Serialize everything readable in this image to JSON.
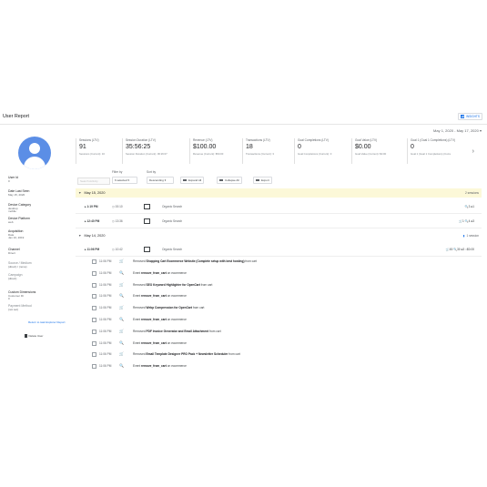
{
  "header": {
    "title": "User Report",
    "insights_label": "INSIGHTS"
  },
  "date_range": "May 1, 2020 - May 17, 2020",
  "user": {
    "fields": [
      {
        "label": "User Id",
        "value": "0"
      },
      {
        "label": "Date Last Seen",
        "value": "May 15, 2020"
      },
      {
        "label": "Device Category",
        "value": "desktop\nmobile"
      },
      {
        "label": "Device Platform",
        "value": "web"
      },
      {
        "label": "Acquisition",
        "value": "Date\nJan 10, 2019"
      },
      {
        "label": "Channel",
        "value": "Direct"
      },
      {
        "label": "Source / Medium",
        "value": "(direct) / (none)"
      },
      {
        "label": "Campaign",
        "value": "(direct)"
      },
      {
        "label": "Custom Dimensions",
        "value": "Customer ID\n0"
      },
      {
        "label": "Payment Method",
        "value": "(not set)"
      }
    ],
    "back_link": "Return to task Explorer Report",
    "delete_label": "Delete User"
  },
  "metrics": [
    {
      "label": "Sessions (LTV)",
      "value": "91",
      "sub": "Sessions (Current): 16"
    },
    {
      "label": "Session Duration (LTV)",
      "value": "35:56:25",
      "sub": "Session Duration (Current): 06:26:07"
    },
    {
      "label": "Revenue (LTV)",
      "value": "$100.00",
      "sub": "Revenue (Current): $50.00"
    },
    {
      "label": "Transactions (LTV)",
      "value": "18",
      "sub": "Transactions (Current): 3"
    },
    {
      "label": "Goal Completions (LTV)",
      "value": "0",
      "sub": "Goal Completions (Current): 0"
    },
    {
      "label": "Goal Value (LTV)",
      "value": "$0.00",
      "sub": "Goal Value (Current): $0.00"
    },
    {
      "label": "Goal 1 (Goal 1 Completions) (LTV)",
      "value": "0",
      "sub": "Goal 1 (Goal 1 Completions) (Curre"
    }
  ],
  "filters": {
    "filter_by_label": "Filter by",
    "filter_by_value": "6 selected",
    "sort_by_label": "Sort by",
    "sort_by_value": "Descending",
    "expand_label": "Expand All",
    "collapse_label": "Collapse All",
    "export_label": "Export",
    "search_placeholder": "Search Activity"
  },
  "days": [
    {
      "date": "May 15, 2020",
      "right": "2 sessions"
    },
    {
      "date": "May 14, 2020",
      "right": "1 session"
    }
  ],
  "sessions": [
    {
      "time": "1:19 PM",
      "duration": "00:10",
      "source": "Organic Search",
      "right": "🔍3 ●1"
    },
    {
      "time": "12:40 PM",
      "duration": "13:36",
      "source": "Organic Search",
      "right": "🛒1 🔍4 ●3"
    },
    {
      "time": "11:06 PM",
      "duration": "10:42",
      "source": "Organic Search",
      "right": "🛒45 🔍30 ●3 ○$0.00"
    }
  ],
  "events": [
    {
      "time": "11:06 PM",
      "icon": "cart",
      "pre": "Removed ",
      "bold": "Shopping Cart Ecommerce Website (Complete setup with best hosting)",
      "post": " from cart"
    },
    {
      "time": "11:06 PM",
      "icon": "search",
      "pre": "Event ",
      "bold": "remove_from_cart",
      "post": " on ecommerce"
    },
    {
      "time": "11:06 PM",
      "icon": "cart",
      "pre": "Removed ",
      "bold": "SEO Keyword Highlighter for OpenCart",
      "post": " from cart"
    },
    {
      "time": "11:06 PM",
      "icon": "search",
      "pre": "Event ",
      "bold": "remove_from_cart",
      "post": " on ecommerce"
    },
    {
      "time": "11:06 PM",
      "icon": "cart",
      "pre": "Removed ",
      "bold": "Webp Compression for OpenCart",
      "post": " from cart"
    },
    {
      "time": "11:06 PM",
      "icon": "search",
      "pre": "Event ",
      "bold": "remove_from_cart",
      "post": " on ecommerce"
    },
    {
      "time": "11:06 PM",
      "icon": "cart",
      "pre": "Removed ",
      "bold": "PDF Invoice Generator and Email Attachment",
      "post": " from cart"
    },
    {
      "time": "11:06 PM",
      "icon": "search",
      "pre": "Event ",
      "bold": "remove_from_cart",
      "post": " on ecommerce"
    },
    {
      "time": "11:06 PM",
      "icon": "cart",
      "pre": "Removed ",
      "bold": "Email Template Designer PRO Pack + Newsletter Scheduler",
      "post": " from cart"
    },
    {
      "time": "11:06 PM",
      "icon": "search",
      "pre": "Event ",
      "bold": "remove_from_cart",
      "post": " on ecommerce"
    }
  ]
}
